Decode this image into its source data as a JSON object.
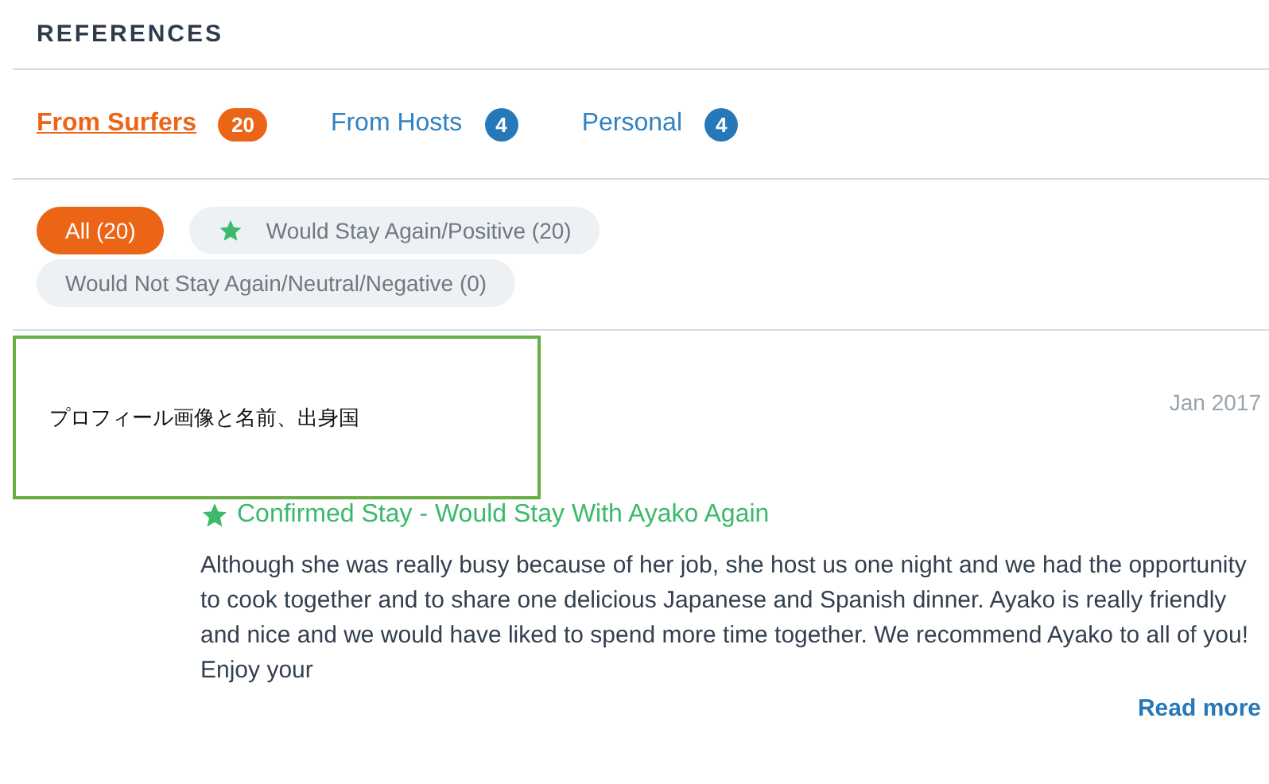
{
  "title": "REFERENCES",
  "tabs": [
    {
      "label": "From Surfers",
      "count": "20",
      "selected": true
    },
    {
      "label": "From Hosts",
      "count": "4",
      "selected": false
    },
    {
      "label": "Personal",
      "count": "4",
      "selected": false
    }
  ],
  "filters": [
    {
      "kind": "plain",
      "label": "All (20)",
      "selected": true
    },
    {
      "kind": "star",
      "label": "Would Stay Again/Positive (20)",
      "selected": false
    },
    {
      "kind": "plain",
      "label": "Would Not Stay Again/Neutral/Negative (0)",
      "selected": false
    }
  ],
  "reference": {
    "annotation": "プロフィール画像と名前、出身国",
    "date": "Jan 2017",
    "status": "Confirmed Stay - Would Stay With Ayako Again",
    "body": "Although she was really busy because of her job, she host us one night and we had the opportunity to cook together and to share one delicious Japanese and Spanish dinner. Ayako is really friendly and nice and we would have liked to spend more time together. We recommend Ayako to all of you! Enjoy your",
    "read_more": "Read more"
  }
}
